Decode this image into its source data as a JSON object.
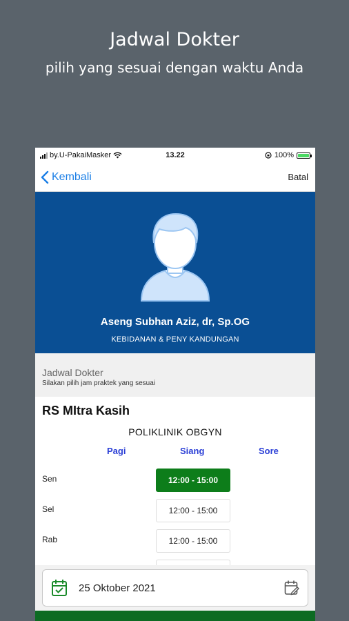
{
  "promo": {
    "title": "Jadwal Dokter",
    "subtitle": "pilih yang sesuai dengan waktu Anda"
  },
  "status_bar": {
    "carrier": "by.U-PakaiMasker",
    "time": "13.22",
    "battery": "100%"
  },
  "nav": {
    "back_label": "Kembali",
    "cancel_label": "Batal"
  },
  "doctor": {
    "name": "Aseng Subhan Aziz, dr, Sp.OG",
    "specialty": "KEBIDANAN & PENY KANDUNGAN"
  },
  "section": {
    "title": "Jadwal Dokter",
    "subtitle": "Silakan pilih jam praktek yang sesuai"
  },
  "schedule": {
    "hospital": "RS MItra Kasih",
    "clinic": "POLIKLINIK OBGYN",
    "columns": [
      "Pagi",
      "Siang",
      "Sore"
    ],
    "rows": [
      {
        "day": "Sen",
        "slot": "12:00 - 15:00",
        "selected": true
      },
      {
        "day": "Sel",
        "slot": "12:00 - 15:00",
        "selected": false
      },
      {
        "day": "Rab",
        "slot": "12:00 - 15:00",
        "selected": false
      }
    ]
  },
  "date_picker": {
    "value": "25 Oktober 2021"
  },
  "colors": {
    "hero": "#0a4f94",
    "selected_slot": "#0d7d1a",
    "accent_link": "#1a7ee6",
    "column_header": "#2b3fd6"
  },
  "icons": [
    "wifi-icon",
    "signal-icon",
    "battery-icon",
    "chevron-left-icon",
    "doctor-avatar-icon",
    "calendar-check-icon",
    "calendar-edit-icon"
  ]
}
